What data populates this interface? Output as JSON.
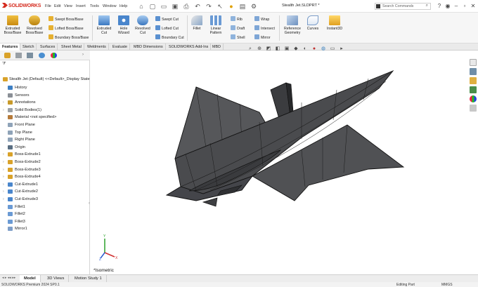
{
  "app": {
    "logo": "SOLIDWORKS"
  },
  "menu": [
    "File",
    "Edit",
    "View",
    "Insert",
    "Tools",
    "Window",
    "Help"
  ],
  "quick_access_icons": [
    "home-icon",
    "new-document-icon",
    "open-icon",
    "save-icon",
    "print-icon",
    "undo-icon",
    "redo-icon",
    "select-icon",
    "rebuild-icon",
    "file-properties-icon",
    "options-icon"
  ],
  "document_title": "Stealth Jet.SLDPRT *",
  "search": {
    "placeholder": "Search Commands"
  },
  "window_controls": [
    "help-icon",
    "user-icon",
    "minimize-icon",
    "restore-icon",
    "close-icon"
  ],
  "ribbon": {
    "extruded_boss": "Extruded Boss/Base",
    "revolved_boss": "Revolved Boss/Base",
    "swept_boss": "Swept Boss/Base",
    "lofted_boss": "Lofted Boss/Base",
    "boundary_boss": "Boundary Boss/Base",
    "extruded_cut": "Extruded Cut",
    "hole_wizard": "Hole Wizard",
    "revolved_cut": "Revolved Cut",
    "swept_cut": "Swept Cut",
    "lofted_cut": "Lofted Cut",
    "boundary_cut": "Boundary Cut",
    "fillet": "Fillet",
    "linear_pattern": "Linear Pattern",
    "rib": "Rib",
    "draft": "Draft",
    "shell": "Shell",
    "wrap": "Wrap",
    "intersect": "Intersect",
    "mirror": "Mirror",
    "reference_geometry": "Reference Geometry",
    "curves": "Curves",
    "instant3d": "Instant3D"
  },
  "command_tabs": [
    "Features",
    "Sketch",
    "Surfaces",
    "Sheet Metal",
    "Weldments",
    "Evaluate",
    "MBD Dimensions",
    "SOLIDWORKS Add-Ins",
    "MBD"
  ],
  "active_command_tab": "Features",
  "view_toolbar_icons": [
    "zoom-to-fit-icon",
    "zoom-area-icon",
    "previous-view-icon",
    "section-view-icon",
    "view-orientation-icon",
    "display-style-icon",
    "hide-show-icon",
    "edit-appearance-icon",
    "apply-scene-icon",
    "view-settings-icon",
    "display-pane-icon"
  ],
  "feature_tree": {
    "root": "Stealth Jet  (Default) <<Default>_Display State",
    "items": [
      {
        "label": "History",
        "expandable": false
      },
      {
        "label": "Sensors",
        "expandable": false
      },
      {
        "label": "Annotations",
        "expandable": true
      },
      {
        "label": "Solid Bodies(1)",
        "expandable": true
      },
      {
        "label": "Material <not specified>",
        "expandable": false
      },
      {
        "label": "Front Plane",
        "expandable": false
      },
      {
        "label": "Top Plane",
        "expandable": false
      },
      {
        "label": "Right Plane",
        "expandable": false
      },
      {
        "label": "Origin",
        "expandable": false
      },
      {
        "label": "Boss-Extrude1",
        "expandable": true
      },
      {
        "label": "Boss-Extrude2",
        "expandable": true
      },
      {
        "label": "Boss-Extrude3",
        "expandable": true
      },
      {
        "label": "Boss-Extrude4",
        "expandable": true
      },
      {
        "label": "Cut-Extrude1",
        "expandable": true
      },
      {
        "label": "Cut-Extrude2",
        "expandable": true
      },
      {
        "label": "Cut-Extrude3",
        "expandable": true
      },
      {
        "label": "Fillet1",
        "expandable": false
      },
      {
        "label": "Fillet2",
        "expandable": false
      },
      {
        "label": "Fillet3",
        "expandable": false
      },
      {
        "label": "Mirror1",
        "expandable": false
      }
    ]
  },
  "viewport": {
    "view_label": "*Isometric",
    "model_color": "#4a4b4e",
    "edge_color": "#1a1a1a"
  },
  "bottom_tabs": [
    "Model",
    "3D Views",
    "Motion Study 1"
  ],
  "active_bottom_tab": "Model",
  "status": {
    "left": "SOLIDWORKS Premium 2024 SP0.1",
    "mode": "Editing Part",
    "units": "MMGS"
  }
}
